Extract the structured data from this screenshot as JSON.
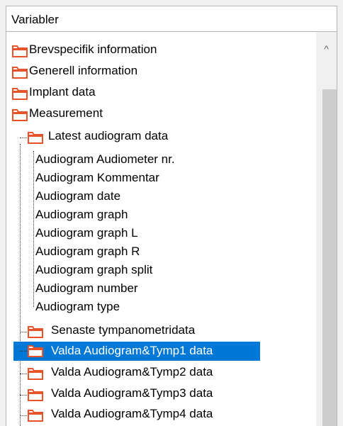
{
  "header": {
    "title": "Variabler"
  },
  "scrollbar": {
    "up_arrow_glyph": "^"
  },
  "colors": {
    "folder": "#e8542a",
    "selection": "#0078d7"
  },
  "tree": {
    "top_level": [
      {
        "label": "Brevspecifik information",
        "icon": "folder-icon"
      },
      {
        "label": "Generell information",
        "icon": "folder-icon"
      },
      {
        "label": "Implant data",
        "icon": "folder-icon"
      },
      {
        "label": "Measurement",
        "icon": "folder-icon"
      }
    ],
    "latest_audiogram": {
      "label": "Latest audiogram data",
      "fields": [
        "Audiogram Audiometer nr.",
        "Audiogram Kommentar",
        "Audiogram date",
        "Audiogram graph",
        "Audiogram graph L",
        "Audiogram graph R",
        "Audiogram graph split",
        "Audiogram number",
        "Audiogram type"
      ]
    },
    "measurement_children": [
      {
        "label": "Senaste tympanometridata",
        "selected": false
      },
      {
        "label": "Valda Audiogram&Tymp1 data",
        "selected": true
      },
      {
        "label": "Valda Audiogram&Tymp2 data",
        "selected": false
      },
      {
        "label": "Valda Audiogram&Tymp3 data",
        "selected": false
      },
      {
        "label": "Valda Audiogram&Tymp4 data",
        "selected": false
      }
    ]
  }
}
